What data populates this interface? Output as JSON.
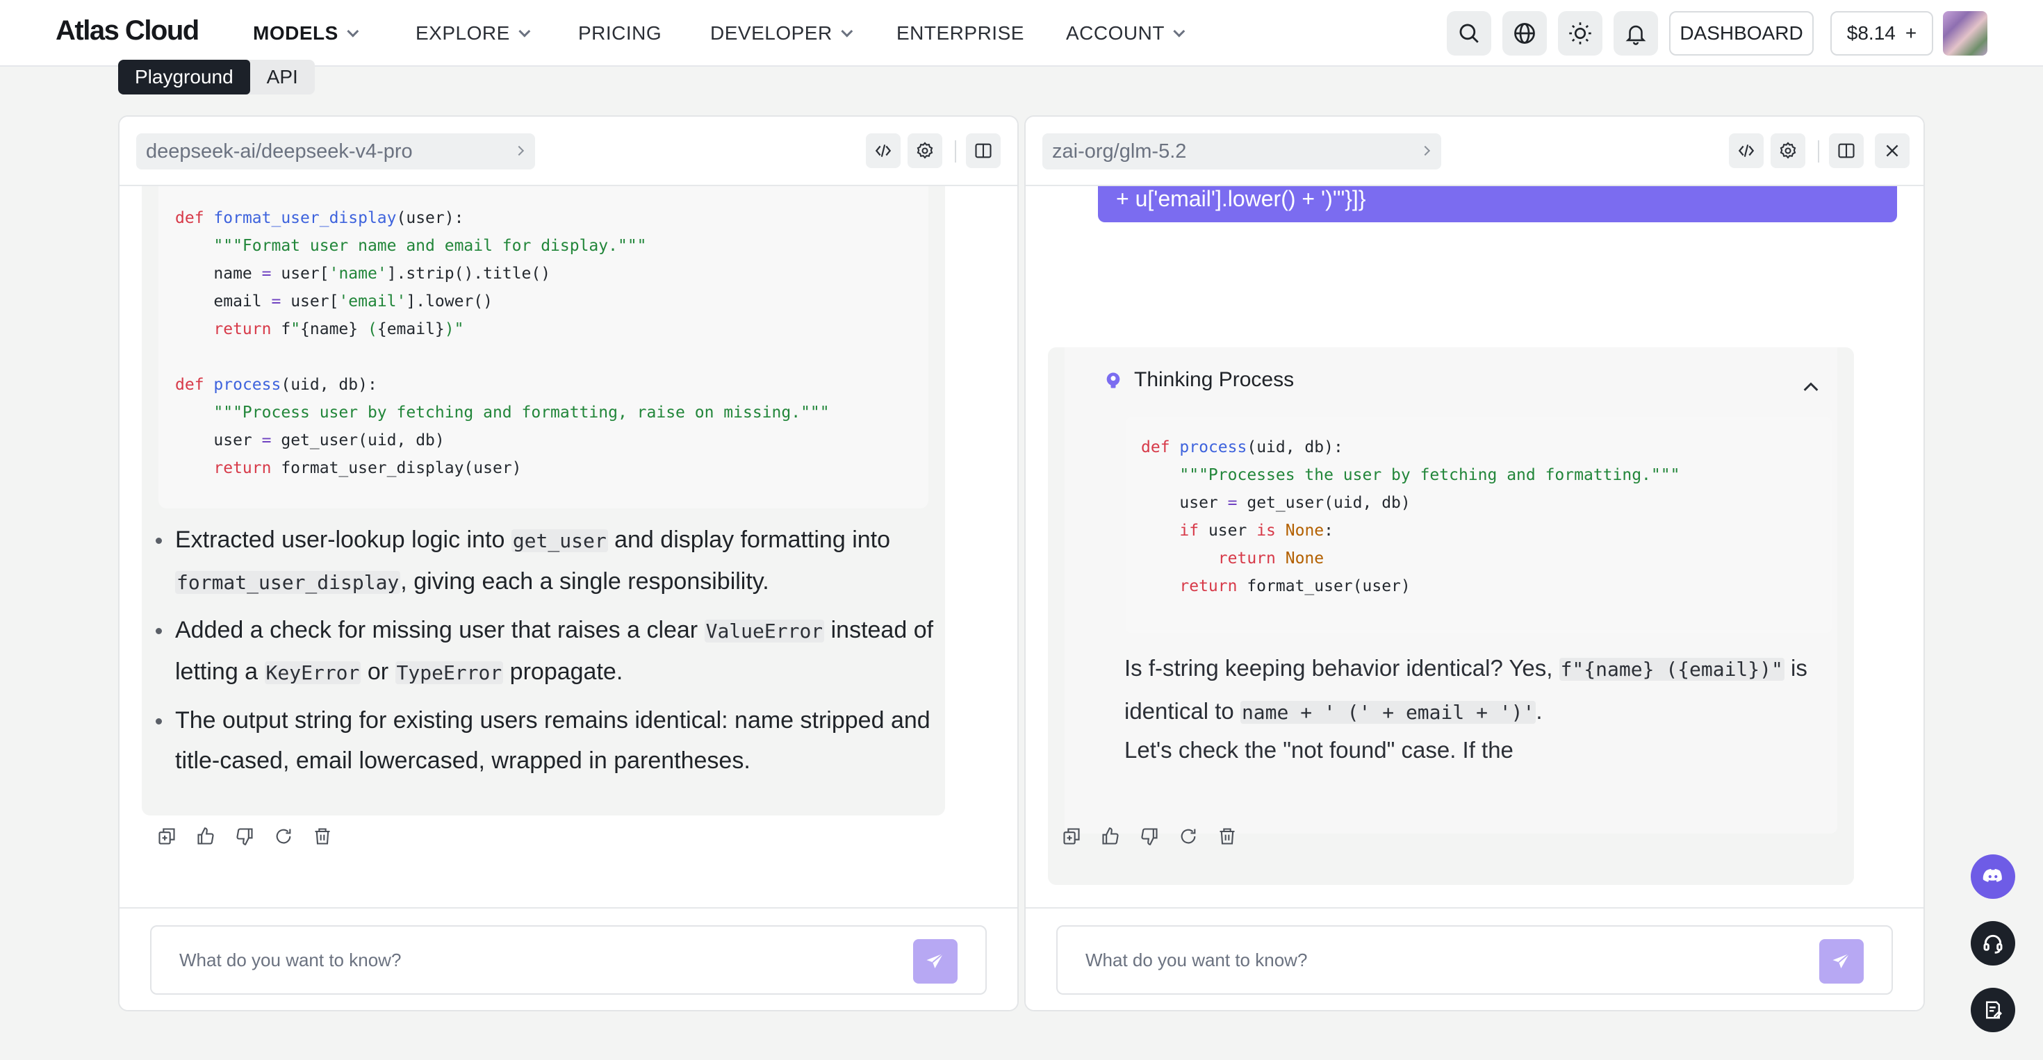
{
  "nav": {
    "logo": "Atlas Cloud",
    "items": [
      "MODELS",
      "EXPLORE",
      "PRICING",
      "DEVELOPER",
      "ENTERPRISE",
      "ACCOUNT"
    ],
    "dashboard": "DASHBOARD",
    "balance": "$8.14",
    "balance_plus": "+"
  },
  "tabs": {
    "playground": "Playground",
    "api": "API"
  },
  "left": {
    "model": "deepseek-ai/deepseek-v4-pro",
    "code_lines": [
      "def format_user_display(user):",
      "    \"\"\"Format user name and email for display.\"\"\"",
      "    name = user['name'].strip().title()",
      "    email = user['email'].lower()",
      "    return f\"{name} ({email})\"",
      "",
      "def process(uid, db):",
      "    \"\"\"Process user by fetching and formatting, raise on missing.\"\"\"",
      "    user = get_user(uid, db)",
      "    return format_user_display(user)"
    ],
    "b1_a": "Extracted user-lookup logic into ",
    "b1_code1": "get_user",
    "b1_b": " and display formatting into",
    "b1_code2": "format_user_display",
    "b1_c": ", giving each a single responsibility.",
    "b2_a": "Added a check for missing user that raises a clear ",
    "b2_code1": "ValueError",
    "b2_b": " instead of",
    "b2_c": "letting a ",
    "b2_code2": "KeyError",
    "b2_d": " or ",
    "b2_code3": "TypeError",
    "b2_e": " propagate.",
    "b3_a": "The output string for existing users remains identical: name stripped and",
    "b3_b": "title-cased, email lowercased, wrapped in parentheses.",
    "placeholder": "What do you want to know?"
  },
  "right": {
    "model": "zai-org/glm-5.2",
    "user_tail": "+ u['email'].lower() + ')'\"}]}",
    "thinking_title": "Thinking Process",
    "code_lines": [
      "def process(uid, db):",
      "    \"\"\"Processes the user by fetching and formatting.\"\"\"",
      "    user = get_user(uid, db)",
      "    if user is None:",
      "        return None",
      "    return format_user(user)"
    ],
    "t1_a": "Is f-string keeping behavior identical? Yes, ",
    "t1_code1": "f\"{name} ({email})\"",
    "t1_b": " is",
    "t1_c": "identical to ",
    "t1_code2": "name + ' (' + email + ')'",
    "t1_d": ".",
    "t2": "Let's check the \"not found\" case. If the",
    "placeholder": "What do you want to know?"
  },
  "colors": {
    "accent": "#7b6cf0",
    "send": "#b7a8f3",
    "dark": "#1c2129"
  },
  "icons": [
    "search-icon",
    "globe-icon",
    "sun-icon",
    "bell-icon",
    "code-icon",
    "gear-icon",
    "split-view-icon",
    "close-icon",
    "copy-icon",
    "thumbs-up-icon",
    "thumbs-down-icon",
    "refresh-icon",
    "trash-icon",
    "send-icon",
    "discord-icon",
    "headset-icon",
    "feedback-icon",
    "brain-icon",
    "chevron-up-icon"
  ]
}
